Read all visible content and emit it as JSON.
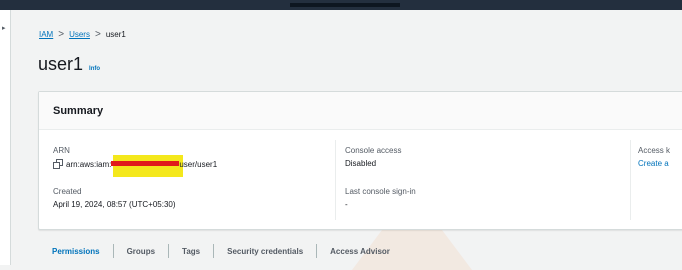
{
  "breadcrumb": {
    "items": [
      "IAM",
      "Users"
    ],
    "current": "user1",
    "separator": ">"
  },
  "page": {
    "title": "user1",
    "info_link": "Info"
  },
  "summary": {
    "heading": "Summary",
    "arn": {
      "label": "ARN",
      "prefix": "arn:aws:iam:",
      "suffix": "user/user1"
    },
    "created": {
      "label": "Created",
      "value": "April 19, 2024, 08:57 (UTC+05:30)"
    },
    "console_access": {
      "label": "Console access",
      "value": "Disabled"
    },
    "last_console_signin": {
      "label": "Last console sign-in",
      "value": "-"
    },
    "access_keys": {
      "label": "Access k",
      "link": "Create a"
    }
  },
  "tabs": [
    "Permissions",
    "Groups",
    "Tags",
    "Security credentials",
    "Access Advisor"
  ],
  "active_tab": "Permissions",
  "colors": {
    "link": "#0073bb",
    "nav": "#232f3e",
    "page_bg": "#f2f3f3"
  },
  "icons": {
    "copy": "copy-icon"
  }
}
